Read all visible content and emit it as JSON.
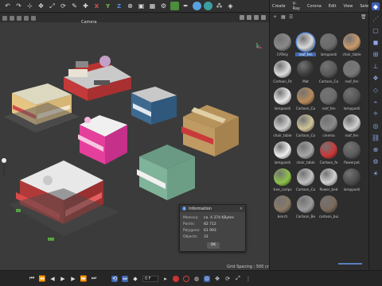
{
  "viewport": {
    "camera_label": "Camera",
    "grid_spacing": "Grid Spacing : 500 cm"
  },
  "info_dialog": {
    "title": "Information",
    "rows": [
      {
        "label": "Memory:",
        "value": "ca. 4 374 KBytes"
      },
      {
        "label": "Points:",
        "value": "82 712"
      },
      {
        "label": "Polygons:",
        "value": "61 993"
      },
      {
        "label": "Objects:",
        "value": "31"
      }
    ],
    "ok_label": "OK"
  },
  "material_manager": {
    "menu": [
      "Create",
      "V-Ray",
      "Corona",
      "Edit",
      "View",
      "Select"
    ],
    "materials": [
      {
        "name": "CATsky",
        "color": "#8a8a8a",
        "selected": false
      },
      {
        "name": "roof_fen",
        "color": "#d9d9d9",
        "selected": true
      },
      {
        "name": "lampposti",
        "color": "#6b6b6b",
        "selected": false
      },
      {
        "name": "chair_table",
        "color": "#c99a6a",
        "selected": false
      },
      {
        "name": "Cartoon_Pz",
        "color": "#dcdcdc",
        "selected": false
      },
      {
        "name": "Mat",
        "color": "#3b3b3b",
        "selected": false
      },
      {
        "name": "Cartoon_Ca",
        "color": "#5a5a5a",
        "selected": false
      },
      {
        "name": "roof_fen",
        "color": "#777777",
        "selected": false
      },
      {
        "name": "lampposti",
        "color": "#e8e8e8",
        "selected": false
      },
      {
        "name": "Cartoon_Ca",
        "color": "#b78a5a",
        "selected": false
      },
      {
        "name": "roof_fen",
        "color": "#6c6c6c",
        "selected": false
      },
      {
        "name": "lampposti",
        "color": "#555555",
        "selected": false
      },
      {
        "name": "chair_table",
        "color": "#cfcfcf",
        "selected": false
      },
      {
        "name": "Cartoon_Ca",
        "color": "#cfc39a",
        "selected": false
      },
      {
        "name": "cinema",
        "color": "#8a8a8a",
        "selected": false
      },
      {
        "name": "roof_fen",
        "color": "#d0d0d0",
        "selected": false
      },
      {
        "name": "lampposti",
        "color": "#eeeeee",
        "selected": false
      },
      {
        "name": "chair_table",
        "color": "#a7a7a7",
        "selected": false
      },
      {
        "name": "Cartoon_fe",
        "color": "#c83838",
        "selected": false
      },
      {
        "name": "flowerpot",
        "color": "#5a5a5a",
        "selected": false
      },
      {
        "name": "tree_carlps",
        "color": "#8fc24a",
        "selected": false
      },
      {
        "name": "Cartoon_Ca",
        "color": "#c0c0c0",
        "selected": false
      },
      {
        "name": "flower_bed",
        "color": "#d0d0d0",
        "selected": false
      },
      {
        "name": "lampposti",
        "color": "#4c4c4c",
        "selected": false
      },
      {
        "name": "bench",
        "color": "#8a7a66",
        "selected": false
      },
      {
        "name": "Cartoon_Be",
        "color": "#9a9a9a",
        "selected": false
      },
      {
        "name": "cartoon_bui",
        "color": "#7a6a5a",
        "selected": false
      }
    ]
  },
  "timeline": {
    "frame": "0 F"
  }
}
